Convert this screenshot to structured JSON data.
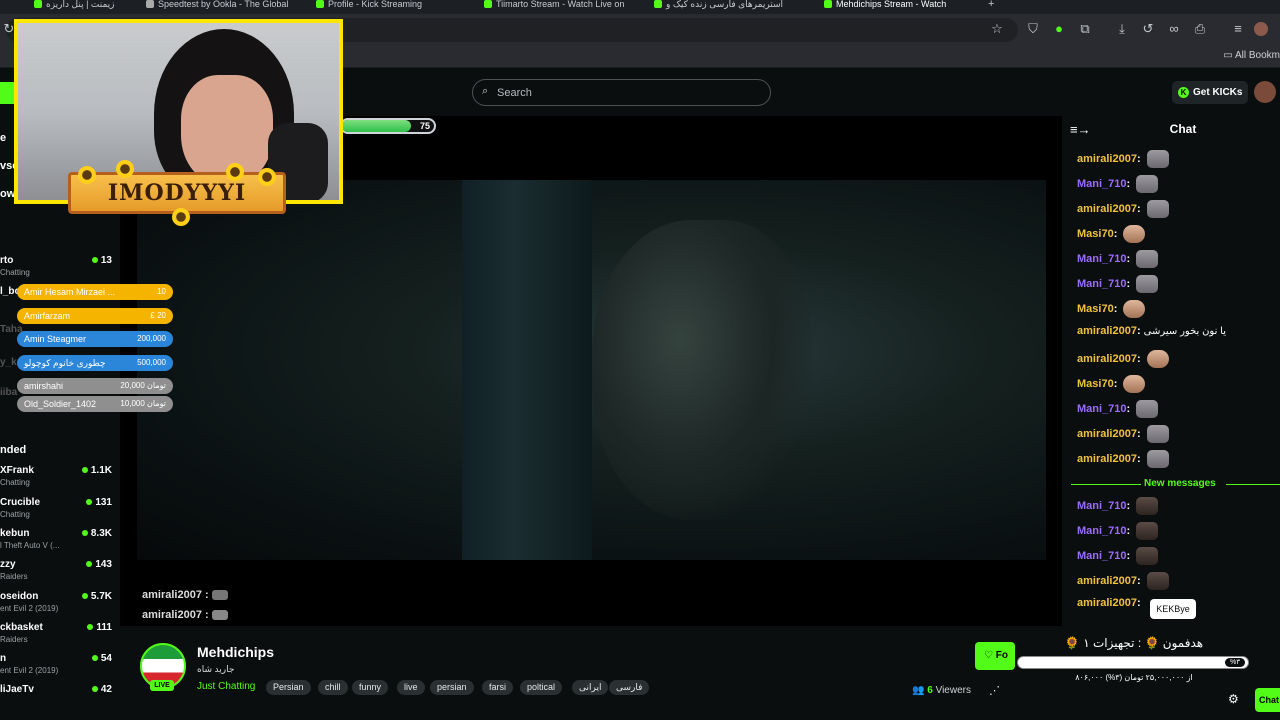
{
  "browser": {
    "tabs": [
      {
        "label": "زیمنت | پنل داریزه"
      },
      {
        "label": "Speedtest by Ookla - The Global"
      },
      {
        "label": "Profile - Kick Streaming"
      },
      {
        "label": "Tiimarto Stream - Watch Live on"
      },
      {
        "label": "استریمرهای فارسی زنده کیک و"
      },
      {
        "label": "Mehdichips Stream - Watch"
      }
    ],
    "new_tab": "+",
    "bookmarks_all": "All Bookm"
  },
  "site": {
    "search_placeholder": "Search",
    "get_kicks": "Get KICKs",
    "kick_glyph": "K"
  },
  "sidebar": {
    "heading_following_fragment": "e",
    "heading_browse_fragment": "vse",
    "heading_following2_fragment": "owi",
    "recommended_heading": "nded",
    "following": [
      {
        "name": "rto",
        "category": "Chatting",
        "count": "13"
      },
      {
        "name": "l_bo",
        "category": "",
        "count": ""
      },
      {
        "name": "Taha",
        "category": "",
        "count": ""
      },
      {
        "name": "y_k",
        "category": "",
        "count": ""
      },
      {
        "name": "iiba",
        "category": "",
        "count": ""
      }
    ],
    "recommended": [
      {
        "name": "XFrank",
        "category": "Chatting",
        "count": "1.1K"
      },
      {
        "name": "Crucible",
        "category": "Chatting",
        "count": "131"
      },
      {
        "name": "kebun",
        "category": "l Theft Auto V (...",
        "count": "8.3K"
      },
      {
        "name": "zzy",
        "category": "Raiders",
        "count": "143"
      },
      {
        "name": "oseidon",
        "category": "ent Evil 2 (2019)",
        "count": "5.7K"
      },
      {
        "name": "ckbasket",
        "category": "Raiders",
        "count": "111"
      },
      {
        "name": "n",
        "category": "ent Evil 2 (2019)",
        "count": "54"
      },
      {
        "name": "liJaeTv",
        "category": "",
        "count": "42"
      }
    ]
  },
  "stream_overlay": {
    "progress_value": "75",
    "progress_fraction": 0.75,
    "banner": "IMODYYYI",
    "donations": [
      {
        "name": "Amir Hesam Mirzaei ...",
        "amount": "10",
        "color": "#f4b400"
      },
      {
        "name": "Amirfarzam",
        "amount": "£ 20",
        "color": "#f4b400"
      },
      {
        "name": "Amin Steagmer",
        "amount": "200,000",
        "color": "#2b86d9"
      },
      {
        "name": "چطوری خانوم کوچولو",
        "amount": "500,000",
        "color": "#2b86d9"
      },
      {
        "name": "amirshahi",
        "amount": "20,000 تومان",
        "color": "#8f8f8f"
      },
      {
        "name": "Old_Soldier_1402",
        "amount": "10,000 تومان",
        "color": "#8f8f8f"
      }
    ],
    "player_chat": [
      {
        "user": "amirali2007 :"
      },
      {
        "user": "amirali2007 :"
      }
    ]
  },
  "chat": {
    "title": "Chat",
    "collapse_icon": "≡→",
    "messages": [
      {
        "user": "amirali2007",
        "color": "#f0c33d",
        "emote": "face",
        "text": ""
      },
      {
        "user": "Mani_710",
        "color": "#9b6bff",
        "emote": "face",
        "text": ""
      },
      {
        "user": "amirali2007",
        "color": "#f0c33d",
        "emote": "face",
        "text": ""
      },
      {
        "user": "Masi70",
        "color": "#f0c33d",
        "emote": "face2",
        "text": ""
      },
      {
        "user": "Mani_710",
        "color": "#9b6bff",
        "emote": "face",
        "text": ""
      },
      {
        "user": "Mani_710",
        "color": "#9b6bff",
        "emote": "face",
        "text": ""
      },
      {
        "user": "Masi70",
        "color": "#f0c33d",
        "emote": "face2",
        "text": ""
      },
      {
        "user": "amirali2007",
        "color": "#f0c33d",
        "emote": "",
        "text": "یا نون بخور سیرشی"
      },
      {
        "user": "amirali2007",
        "color": "#f0c33d",
        "emote": "face2",
        "text": ""
      },
      {
        "user": "Masi70",
        "color": "#f0c33d",
        "emote": "face2",
        "text": ""
      },
      {
        "user": "Mani_710",
        "color": "#9b6bff",
        "emote": "face",
        "text": ""
      },
      {
        "user": "amirali2007",
        "color": "#f0c33d",
        "emote": "face",
        "text": ""
      },
      {
        "user": "amirali2007",
        "color": "#f0c33d",
        "emote": "face",
        "text": ""
      }
    ],
    "new_messages_label": "New messages",
    "new_messages": [
      {
        "user": "Mani_710",
        "color": "#9b6bff",
        "emote": "face3"
      },
      {
        "user": "Mani_710",
        "color": "#9b6bff",
        "emote": "face3"
      },
      {
        "user": "Mani_710",
        "color": "#9b6bff",
        "emote": "face3"
      },
      {
        "user": "amirali2007",
        "color": "#f0c33d",
        "emote": "face3"
      },
      {
        "user": "amirali2007",
        "color": "#f0c33d",
        "emote": ""
      }
    ],
    "tooltip": "KEKBye",
    "button": "Chat"
  },
  "goal": {
    "title": "🌻 هدفمون 🌻 : تجهیزات ۱",
    "percent": "%۳",
    "fraction": 0.03,
    "subtitle": "۸۰۶,۰۰۰ از ۲۵,۰۰۰,۰۰۰ تومان (۳%)"
  },
  "channel": {
    "name": "Mehdichips",
    "subtitle": "جارید شاه",
    "live": "LIVE",
    "category": "Just Chatting",
    "tags": [
      "Persian",
      "chill",
      "funny",
      "live",
      "persian",
      "farsi",
      "poltical",
      "ایرانی",
      "فارسی"
    ],
    "follow": "Fo",
    "viewers_count": "6",
    "viewers_label": "Viewers"
  }
}
